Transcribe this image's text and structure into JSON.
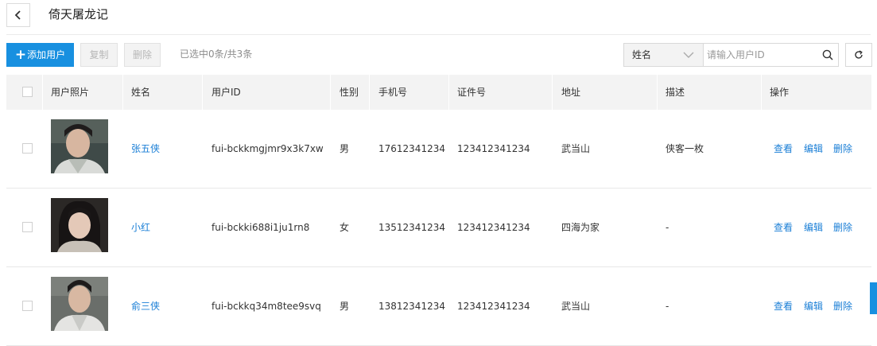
{
  "header": {
    "title": "倚天屠龙记"
  },
  "toolbar": {
    "add_label": "添加用户",
    "copy_label": "复制",
    "delete_label": "删除",
    "selection_info": "已选中0条/共3条",
    "search_field": "姓名",
    "search_placeholder": "请输入用户ID"
  },
  "table": {
    "columns": [
      "用户照片",
      "姓名",
      "用户ID",
      "性别",
      "手机号",
      "证件号",
      "地址",
      "描述",
      "操作"
    ],
    "actions": [
      "查看",
      "编辑",
      "删除"
    ],
    "rows": [
      {
        "name": "张五侠",
        "user_id": "fui-bckkmgjmr9x3k7xw",
        "gender": "男",
        "phone": "17612341234",
        "id_number": "123412341234",
        "address": "武当山",
        "description": "侠客一枚"
      },
      {
        "name": "小红",
        "user_id": "fui-bckki688i1ju1rn8",
        "gender": "女",
        "phone": "13512341234",
        "id_number": "123412341234",
        "address": "四海为家",
        "description": "-"
      },
      {
        "name": "俞三侠",
        "user_id": "fui-bckkq34m8tee9svq",
        "gender": "男",
        "phone": "13812341234",
        "id_number": "123412341234",
        "address": "武当山",
        "description": "-"
      }
    ]
  },
  "colors": {
    "primary": "#1890e0",
    "link": "#1b7fd6"
  }
}
